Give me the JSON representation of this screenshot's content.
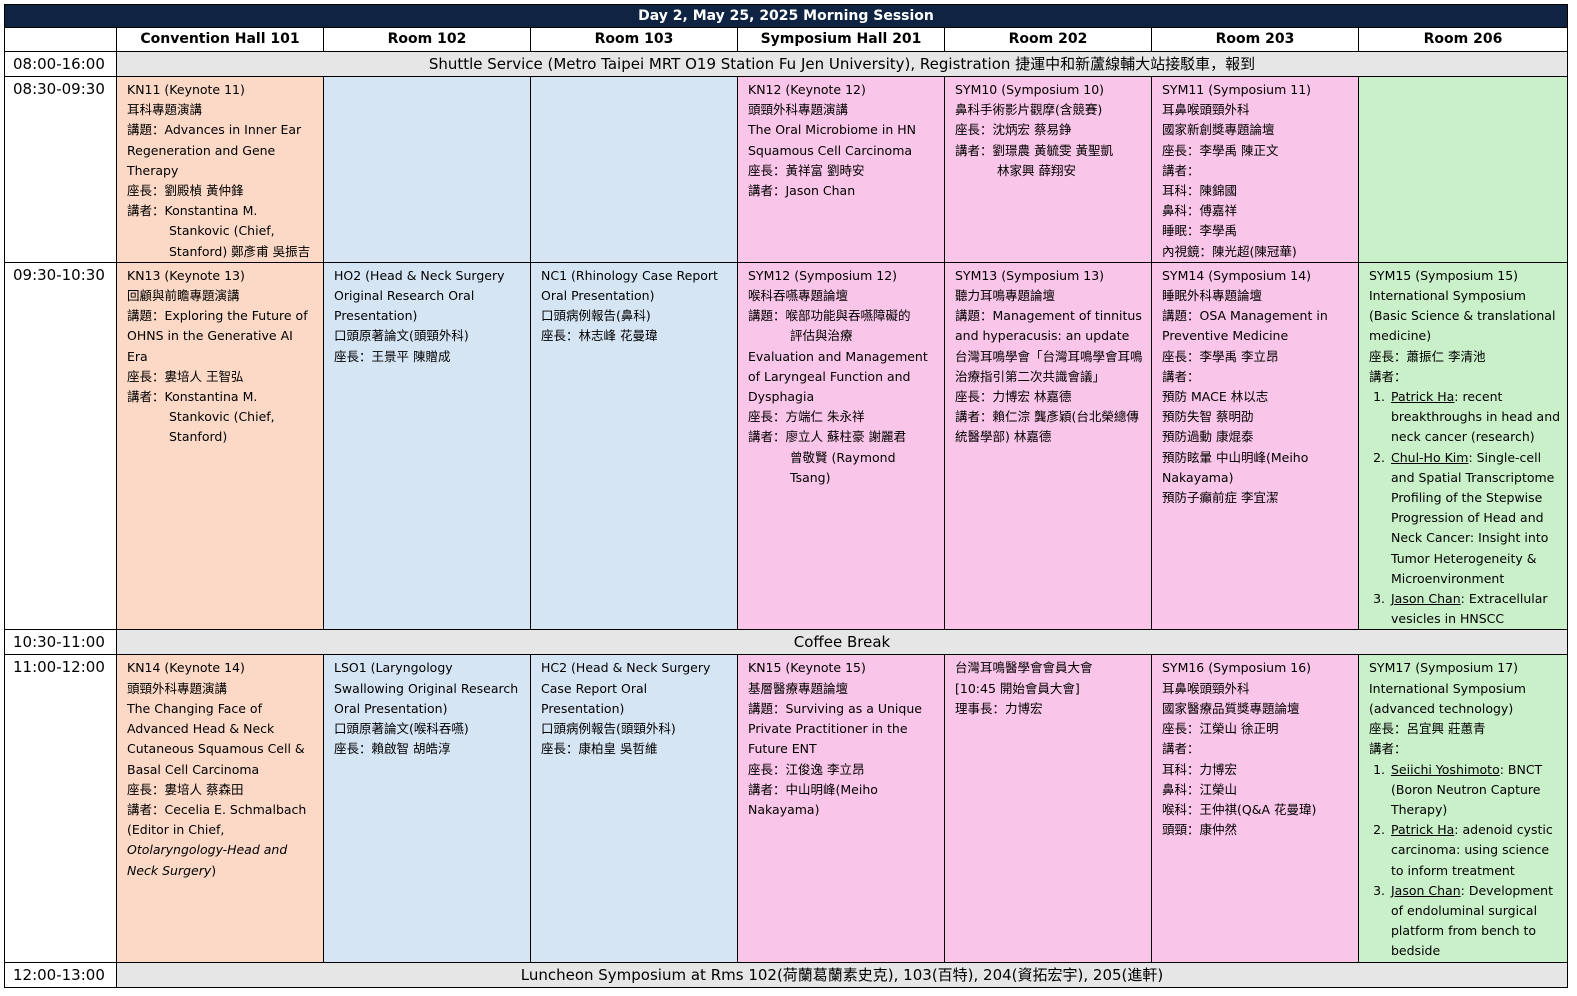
{
  "title": "Day 2, May 25, 2025 Morning Session",
  "headers": [
    "Convention Hall 101",
    "Room 102",
    "Room 103",
    "Symposium Hall 201",
    "Room 202",
    "Room 203",
    "Room 206"
  ],
  "times": {
    "t1": "08:00-16:00",
    "t2": "08:30-09:30",
    "t3": "09:30-10:30",
    "t4": "10:30-11:00",
    "t5": "11:00-12:00",
    "t6": "12:00-13:00"
  },
  "banners": {
    "shuttle": "Shuttle Service (Metro Taipei MRT O19 Station Fu Jen University), Registration  捷運中和新蘆線輔大站接駁車，報到",
    "coffee": "Coffee Break",
    "luncheon": "Luncheon Symposium at Rms 102(荷蘭葛蘭素史克), 103(百特), 204(資拓宏宇), 205(進軒)"
  },
  "row1": {
    "kn11": {
      "code": "KN11 (Keynote 11)",
      "zh": "耳科專題演講",
      "topic": "講題：Advances in Inner Ear Regeneration and Gene Therapy",
      "chair": "座長：劉殿楨  黃仲鋒",
      "sp1": "講者：Konstantina M.",
      "sp2": "Stankovic (Chief,",
      "sp3": "Stanford)  鄭彥甫  吳振吉"
    },
    "kn12": {
      "code": "KN12 (Keynote 12)",
      "zh": "頭頸外科專題演講",
      "topic": "The Oral Microbiome in HN Squamous Cell Carcinoma",
      "chair": "座長：黃祥富  劉時安",
      "speaker": "講者：Jason Chan"
    },
    "sym10": {
      "code": "SYM10 (Symposium 10)",
      "zh": "鼻科手術影片觀摩(含競賽)",
      "chair": "座長：沈炳宏  蔡易錚",
      "sp1": "講者：劉璟農  黃毓雯  黃聖凱",
      "sp2": "林家興  薛翔安"
    },
    "sym11": {
      "code": "SYM11 (Symposium 11)",
      "zh": "耳鼻喉頭頸外科",
      "zh2": "國家新創獎專題論壇",
      "chair": "座長：李學禹  陳正文",
      "speakers": "講者：",
      "s1": "耳科：陳錦國",
      "s2": "鼻科：傅嘉祥",
      "s3": "睡眠：李學禹",
      "s4": "內視鏡：陳光超(陳冠華)"
    }
  },
  "row2": {
    "kn13": {
      "code": "KN13 (Keynote 13)",
      "zh": "回顧與前瞻專題演講",
      "topic": "講題：Exploring the Future of OHNS in the Generative AI Era",
      "chair": "座長：婁培人  王智弘",
      "sp1": "講者：Konstantina M.",
      "sp2": "Stankovic (Chief,",
      "sp3": "Stanford)"
    },
    "ho2": {
      "code": "HO2 (Head & Neck Surgery Original Research Oral Presentation)",
      "zh": "口頭原著論文(頭頸外科)",
      "chair": "座長：王景平  陳贈成"
    },
    "nc1": {
      "code": "NC1 (Rhinology Case Report Oral Presentation)",
      "zh": "口頭病例報告(鼻科)",
      "chair": "座長：林志峰  花曼瑋"
    },
    "sym12": {
      "code": "SYM12 (Symposium 12)",
      "zh": "喉科吞嚥專題論壇",
      "topic1": "講題：喉部功能與吞嚥障礙的",
      "topic2": "評估與治療",
      "en": "Evaluation and Management of Laryngeal Function and Dysphagia",
      "chair": "座長：方端仁  朱永祥",
      "sp1": "講者：廖立人  蘇柱豪  謝麗君",
      "sp2": "曾敬賢  (Raymond Tsang)"
    },
    "sym13": {
      "code": "SYM13 (Symposium 13)",
      "zh": "聽力耳鳴專題論壇",
      "topic": "講題：Management of tinnitus and hyperacusis: an update",
      "zh2": "台灣耳鳴學會「台灣耳鳴學會耳鳴治療指引第二次共識會議」",
      "chair": "座長：力博宏  林嘉德",
      "speaker": "講者：賴仁淙  龔彥穎(台北榮總傳統醫學部)  林嘉德"
    },
    "sym14": {
      "code": "SYM14 (Symposium 14)",
      "zh": "睡眠外科專題論壇",
      "topic": "講題：OSA Management in Preventive Medicine",
      "chair": "座長：李學禹  李立昂",
      "speakers": "講者：",
      "s1": "預防 MACE  林以志",
      "s2": "預防失智  蔡明劭",
      "s3": "預防過動  康焜泰",
      "s4": "預防眩暈  中山明峰(Meiho Nakayama)",
      "s5": "預防子癲前症  李宜潔"
    },
    "sym15": {
      "code": "SYM15 (Symposium 15)",
      "en": "International Symposium (Basic Science & translational medicine)",
      "chair": "座長：蕭振仁  李清池",
      "speakers": "講者：",
      "items": [
        {
          "name": "Patrick Ha",
          "text": ": recent breakthroughs in head and neck cancer (research)"
        },
        {
          "name": "Chul-Ho Kim",
          "text": ": Single-cell and Spatial Transcriptome Profiling of the Stepwise Progression of Head and Neck Cancer: Insight into Tumor Heterogeneity & Microenvironment"
        },
        {
          "name": "Jason Chan",
          "text": ": Extracellular vesicles in HNSCC"
        }
      ]
    }
  },
  "row3": {
    "kn14": {
      "code": "KN14 (Keynote 14)",
      "zh": "頭頸外科專題演講",
      "topic": "The Changing Face of Advanced Head & Neck Cutaneous Squamous Cell & Basal Cell Carcinoma",
      "chair": "座長：婁培人  蔡森田",
      "speaker": "講者：Cecelia E. Schmalbach (Editor in Chief,",
      "journal": "Otolaryngology-Head and Neck Surgery",
      "close": ")"
    },
    "lso1": {
      "code": "LSO1 (Laryngology Swallowing Original Research Oral Presentation)",
      "zh": "口頭原著論文(喉科吞嚥)",
      "chair": "座長：賴啟智  胡皓淳"
    },
    "hc2": {
      "code": "HC2 (Head & Neck Surgery Case Report Oral Presentation)",
      "zh": "口頭病例報告(頭頸外科)",
      "chair": "座長：康柏皇  吳哲維"
    },
    "kn15": {
      "code": "KN15 (Keynote 15)",
      "zh": "基層醫療專題論壇",
      "topic": "講題：Surviving as a Unique Private Practitioner in the Future ENT",
      "chair": "座長：江俊逸  李立昂",
      "speaker": "講者：中山明峰(Meiho Nakayama)"
    },
    "r202": {
      "l1": "台灣耳鳴醫學會會員大會",
      "l2": "[10:45 開始會員大會]",
      "l3": "理事長：力博宏"
    },
    "sym16": {
      "code": "SYM16 (Symposium 16)",
      "zh": "耳鼻喉頭頸外科",
      "zh2": "國家醫療品質獎專題論壇",
      "chair": "座長：江榮山  徐正明",
      "speakers": "講者：",
      "s1": "耳科：力博宏",
      "s2": "鼻科：江榮山",
      "s3": "喉科：王仲祺(Q&A 花曼瑋)",
      "s4": "頭頸：康仲然"
    },
    "sym17": {
      "code": "SYM17 (Symposium 17)",
      "en": "International Symposium (advanced technology)",
      "chair": "座長：呂宜興  莊蕙青",
      "speakers": "講者：",
      "items": [
        {
          "name": "Seiichi Yoshimoto",
          "text": ": BNCT (Boron Neutron Capture Therapy)"
        },
        {
          "name": "Patrick Ha",
          "text": ": adenoid cystic carcinoma: using science to inform treatment"
        },
        {
          "name": "Jason Chan",
          "text": ": Development of endoluminal surgical platform from bench to bedside"
        }
      ]
    }
  },
  "colors": {
    "title_bg": "#0f2443",
    "keynote_peach": "#fbd9c6",
    "oral_blue": "#d6e5f4",
    "symposium_pink": "#f9c5e8",
    "international_green": "#c9f0c9",
    "banner_gray": "#e6e6e6"
  }
}
